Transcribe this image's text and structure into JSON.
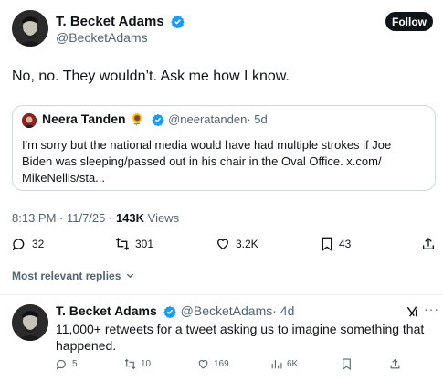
{
  "main_tweet": {
    "author_name": "T. Becket Adams",
    "author_handle": "@BecketAdams",
    "follow_label": "Follow",
    "text": "No, no. They wouldn’t. Ask me how I know."
  },
  "quote": {
    "author_name": "Neera Tanden",
    "emoji": "🌻",
    "author_handle": "@neeratanden",
    "age": "· 5d",
    "text_line1": "I'm sorry but the national media would have had multiple strokes if Joe",
    "text_line2": "Biden was sleeping/passed out in his chair in the Oval Office. x.com/",
    "text_line3": "MikeNellis/sta..."
  },
  "meta": {
    "timestamp": "8:13 PM · 11/7/25 · ",
    "views_count": "143K",
    "views_label": " Views"
  },
  "actions": {
    "replies": "32",
    "retweets": "301",
    "likes": "3.2K",
    "bookmarks": "43"
  },
  "sort": {
    "label": "Most relevant replies"
  },
  "reply": {
    "author_name": "T. Becket Adams",
    "author_handle": "@BecketAdams",
    "age": "· 4d",
    "text_line1": "11,000+ retweets for a tweet asking us to imagine something that",
    "text_line2": "happened.",
    "replies": "5",
    "retweets": "10",
    "likes": "169",
    "views": "6K"
  },
  "colors": {
    "verified": "#1d9bf0",
    "text": "#0f1419",
    "muted": "#536471",
    "border": "#cfd9de"
  }
}
